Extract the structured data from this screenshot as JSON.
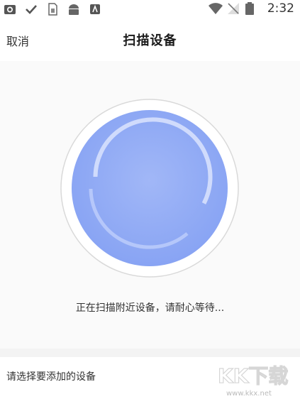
{
  "status_bar": {
    "time": "2:32",
    "icons_left": [
      "camera-icon",
      "check-icon",
      "sim-icon",
      "android-icon",
      "app-icon"
    ],
    "icons_right": [
      "wifi-icon",
      "signal-icon",
      "battery-icon"
    ]
  },
  "header": {
    "cancel_label": "取消",
    "title": "扫描设备"
  },
  "scan": {
    "status_text": "正在扫描附近设备，请耐心等待...",
    "ring_color": "#8aa6f4",
    "ring_highlight": "#b4c6fb"
  },
  "devices_section": {
    "label": "请选择要添加的设备"
  },
  "watermark": {
    "logo_text": "KK下载",
    "url": "www.kkx.net"
  }
}
